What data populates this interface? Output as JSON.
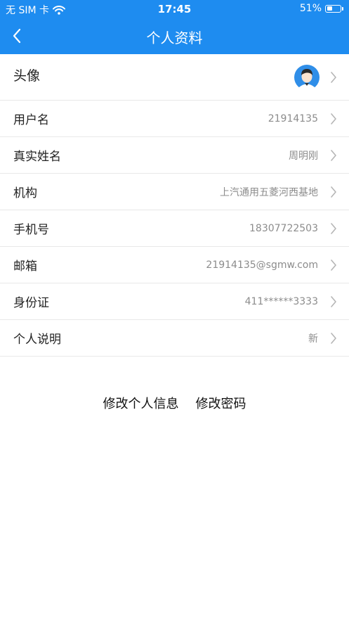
{
  "status_bar": {
    "carrier": "无 SIM 卡",
    "time": "17:45",
    "battery_percent_label": "51%",
    "battery_level": 0.51,
    "wifi_icon": "wifi-icon"
  },
  "nav": {
    "title": "个人资料",
    "back_icon": "chevron-left-icon"
  },
  "profile": {
    "avatar_label": "头像",
    "rows": [
      {
        "label": "用户名",
        "value": "21914135"
      },
      {
        "label": "真实姓名",
        "value": "周明刚"
      },
      {
        "label": "机构",
        "value": "上汽通用五菱河西基地"
      },
      {
        "label": "手机号",
        "value": "18307722503"
      },
      {
        "label": "邮箱",
        "value": "21914135@sgmw.com"
      },
      {
        "label": "身份证",
        "value": "411******3333"
      },
      {
        "label": "个人说明",
        "value": "新"
      }
    ]
  },
  "actions": {
    "edit_info": "修改个人信息",
    "change_password": "修改密码"
  },
  "colors": {
    "header_bg": "#1e8cf0",
    "value_text": "#8c8c8c",
    "divider": "#e8e8e8"
  }
}
